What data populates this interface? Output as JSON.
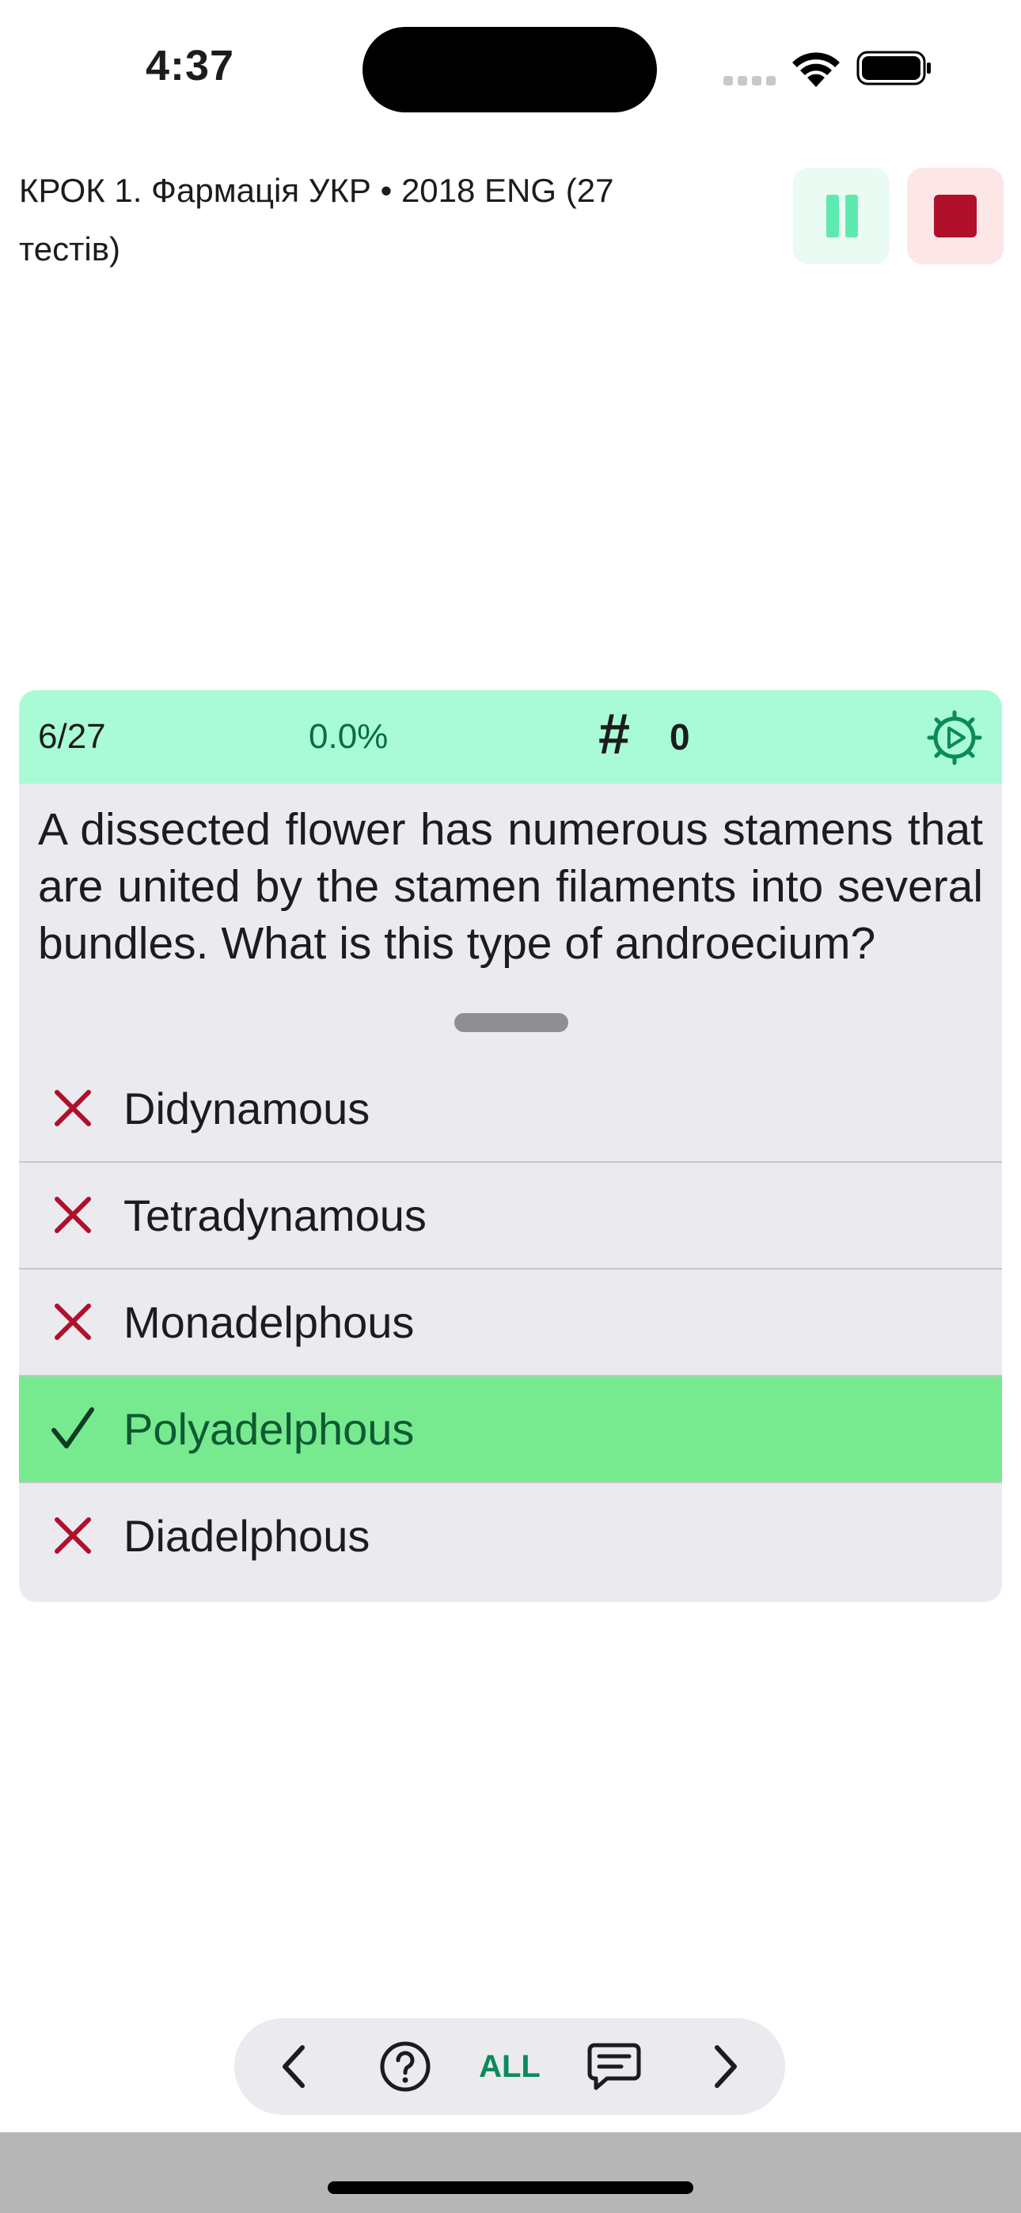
{
  "status_bar": {
    "time": "4:37"
  },
  "header": {
    "title": "КРОК 1. Фармація УКР • 2018 ENG (27 тестів)",
    "pause_color": "#5ee9b0",
    "stop_color": "#b0102a"
  },
  "card": {
    "progress": "6/27",
    "percent": "0.0%",
    "hash_symbol": "#",
    "hash_count": "0",
    "question": "A dissected flower has numerous stamens that are united by the stamen filaments into several bundles. What is this type of androecium?",
    "answers": [
      {
        "label": "Didynamous",
        "state": "wrong",
        "icon": "x-icon"
      },
      {
        "label": "Tetradynamous",
        "state": "wrong",
        "icon": "x-icon"
      },
      {
        "label": "Monadelphous",
        "state": "wrong",
        "icon": "x-icon"
      },
      {
        "label": "Polyadelphous",
        "state": "correct",
        "icon": "check-icon"
      },
      {
        "label": "Diadelphous",
        "state": "wrong",
        "icon": "x-icon"
      }
    ],
    "accent_color": "#a8fbd6",
    "correct_color": "#77ea90",
    "wrong_mark_color": "#b0102a"
  },
  "nav": {
    "all_label": "ALL",
    "icons": [
      "chevron-left-icon",
      "help-icon",
      "comment-icon",
      "chevron-right-icon"
    ]
  }
}
